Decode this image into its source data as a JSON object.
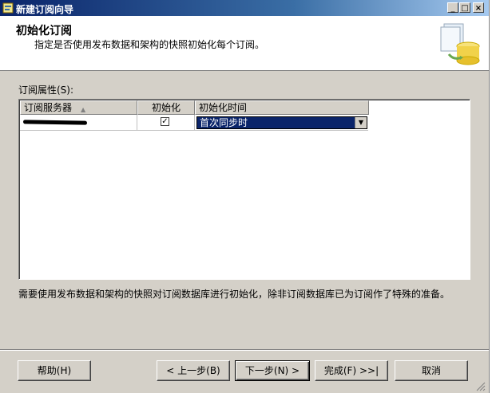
{
  "window": {
    "title": "新建订阅向导",
    "min_label": "_",
    "max_label": "□",
    "close_label": "×"
  },
  "header": {
    "title": "初始化订阅",
    "subtitle": "指定是否使用发布数据和架构的快照初始化每个订阅。"
  },
  "properties_label": "订阅属性(S):",
  "grid": {
    "columns": [
      "订阅服务器",
      "初始化",
      "初始化时间"
    ],
    "sort_indicator": "▲",
    "rows": [
      {
        "subscriber": "",
        "initialize": true,
        "check_glyph": "✓",
        "init_time": "首次同步时",
        "dropdown_glyph": "▼"
      }
    ]
  },
  "description": "需要使用发布数据和架构的快照对订阅数据库进行初始化，除非订阅数据库已为订阅作了特殊的准备。",
  "buttons": {
    "help": "帮助(H)",
    "back": "< 上一步(B)",
    "next": "下一步(N) >",
    "finish": "完成(F) >>|",
    "cancel": "取消"
  },
  "icons": {
    "app": "wizard-icon",
    "header": "database-sync-icon",
    "grip": "resize-grip-icon"
  }
}
